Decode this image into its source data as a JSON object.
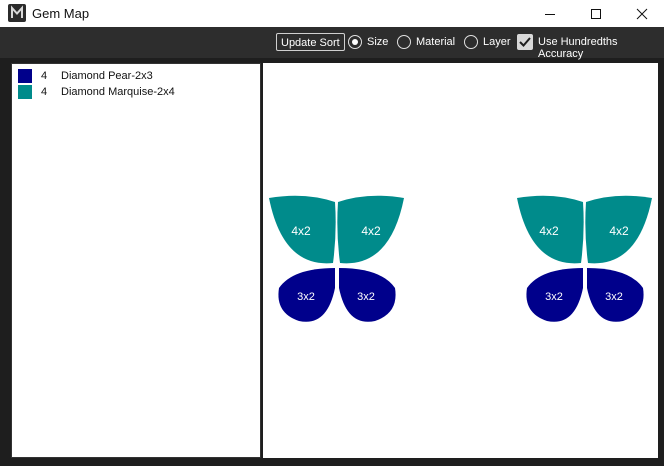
{
  "window": {
    "title": "Gem Map",
    "app_icon": "m-logo-icon",
    "controls": [
      "minimize-icon",
      "maximize-icon",
      "close-icon"
    ]
  },
  "toolbar": {
    "update_sort_label": "Update Sort",
    "sort_options": [
      {
        "label": "Size",
        "selected": true
      },
      {
        "label": "Material",
        "selected": false
      },
      {
        "label": "Layer",
        "selected": false
      }
    ],
    "accuracy_label": "Use Hundredths Accuracy",
    "accuracy_checked": true
  },
  "legend": {
    "items": [
      {
        "count": "4",
        "name": "Diamond Pear-2x3",
        "color": "#00008b"
      },
      {
        "count": "4",
        "name": "Diamond Marquise-2x4",
        "color": "#008b8b"
      }
    ]
  },
  "gem_map": {
    "groups": [
      {
        "marquise_labels": [
          "4x2",
          "4x2"
        ],
        "pear_labels": [
          "3x2",
          "3x2"
        ]
      },
      {
        "marquise_labels": [
          "4x2",
          "4x2"
        ],
        "pear_labels": [
          "3x2",
          "3x2"
        ]
      }
    ]
  }
}
